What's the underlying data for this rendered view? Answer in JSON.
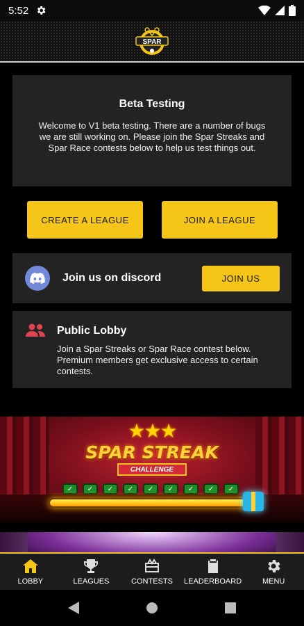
{
  "status_bar": {
    "time": "5:52"
  },
  "header": {
    "logo_text": "SPAR"
  },
  "beta_card": {
    "title": "Beta Testing",
    "body": "Welcome to V1 beta testing. There are a number of bugs we are still working on. Please join the Spar Streaks and Spar Race contests below to help us test things out."
  },
  "actions": {
    "create_league": "CREATE A LEAGUE",
    "join_league": "JOIN A LEAGUE"
  },
  "discord": {
    "label": "Join us on discord",
    "button": "JOIN US"
  },
  "lobby": {
    "title": "Public Lobby",
    "body": "Join a Spar Streaks or Spar Race contest below. Premium members get exclusive access to certain contests."
  },
  "banner": {
    "title": "SPAR STREAK",
    "subtitle": "CHALLENGE",
    "completed_checks": 9
  },
  "nav": {
    "items": [
      {
        "label": "LOBBY",
        "icon": "home-icon"
      },
      {
        "label": "LEAGUES",
        "icon": "trophy-icon"
      },
      {
        "label": "CONTESTS",
        "icon": "ticket-icon"
      },
      {
        "label": "LEADERBOARD",
        "icon": "clipboard-icon"
      },
      {
        "label": "MENU",
        "icon": "gear-icon"
      }
    ],
    "active": "LOBBY"
  },
  "colors": {
    "accent": "#f5c518",
    "card": "#232323",
    "discord": "#7289da",
    "lobby_icon": "#e0454f"
  }
}
